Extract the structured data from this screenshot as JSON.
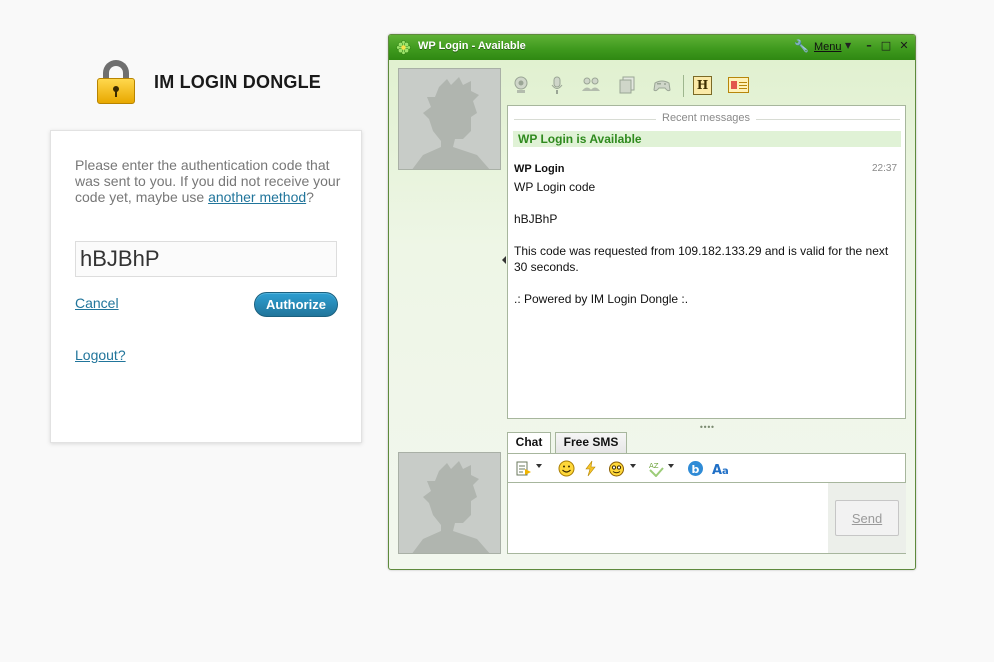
{
  "brand": {
    "title": "IM LOGIN DONGLE"
  },
  "login": {
    "message": "Please enter the authentication code that was sent to you. If you did not receive your code yet, maybe use ",
    "another_method": "another method",
    "message_end": "?",
    "code_value": "hBJBhP",
    "cancel": "Cancel",
    "authorize": "Authorize",
    "logout": "Logout?"
  },
  "im": {
    "title": "WP Login - Available",
    "menu": "Menu",
    "recent_label": "Recent messages",
    "status": "WP Login is Available",
    "message": {
      "sender": "WP Login",
      "time": "22:37",
      "lines": [
        "WP Login code",
        "hBJBhP",
        "This code was requested from 109.182.133.29 and is valid for the next 30 seconds.",
        ".: Powered by IM Login Dongle :."
      ]
    },
    "tabs": [
      "Chat",
      "Free SMS"
    ],
    "send": "Send"
  }
}
